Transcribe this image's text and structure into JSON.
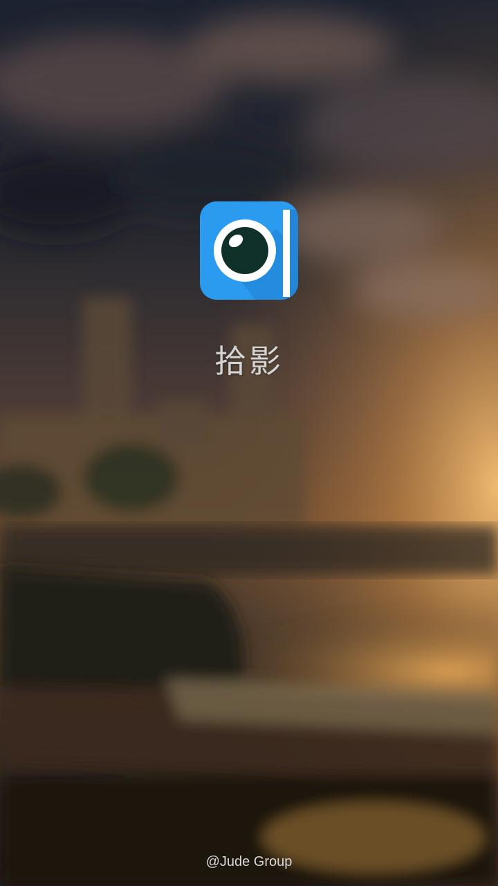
{
  "splash": {
    "app_name": "拾影",
    "icon": "camera-lens-notebook-icon",
    "credit": "@Jude Group"
  },
  "colors": {
    "icon_blue": "#2b9bf0",
    "icon_spine": "#ffffff",
    "lens_dark": "#10302a",
    "title_text": "#d4d4d4"
  }
}
